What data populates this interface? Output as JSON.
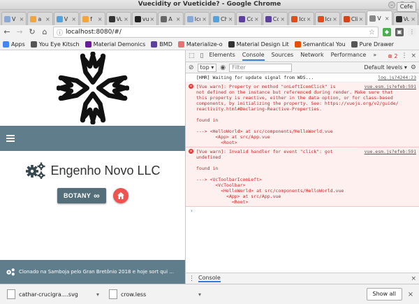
{
  "window": {
    "title": "Vuecidity or Vueticide? - Google Chrome",
    "profile": "Cefe"
  },
  "tabs": [
    {
      "label": "V",
      "color": "#8aa8d6"
    },
    {
      "label": "a",
      "color": "#f3a43a"
    },
    {
      "label": "V",
      "color": "#4fa3e0"
    },
    {
      "label": "f",
      "color": "#f3a43a"
    },
    {
      "label": "Vue",
      "color": "#333333"
    },
    {
      "label": "vue",
      "color": "#222222"
    },
    {
      "label": "A p",
      "color": "#666666"
    },
    {
      "label": "Icon",
      "color": "#8aa8d6"
    },
    {
      "label": "Che",
      "color": "#4fa3e0"
    },
    {
      "label": "Con",
      "color": "#5c3f9e"
    },
    {
      "label": "Con",
      "color": "#5c3f9e"
    },
    {
      "label": "Icon",
      "color": "#e64a19"
    },
    {
      "label": "Icon",
      "color": "#e64a19"
    },
    {
      "label": "Clic",
      "color": "#d84315"
    },
    {
      "label": "V",
      "color": "#888888",
      "active": true
    },
    {
      "label": "Vue",
      "color": "#333333"
    }
  ],
  "address": {
    "url": "localhost:8080/#/"
  },
  "bookmarks": [
    {
      "label": "Apps",
      "color": "#4285f4"
    },
    {
      "label": "You Eye Kitsch",
      "color": "#555555"
    },
    {
      "label": "Material Demonics",
      "color": "#6a1b9a"
    },
    {
      "label": "BMD",
      "color": "#5c3f9e"
    },
    {
      "label": "Materialize-o",
      "color": "#ee6e73"
    },
    {
      "label": "Material Design Lit",
      "color": "#333333"
    },
    {
      "label": "Semantical You",
      "color": "#e65100"
    },
    {
      "label": "Pure Drawer",
      "color": "#555555"
    }
  ],
  "app": {
    "company": "Engenho Novo LLC",
    "botany_label": "BOTANY",
    "footer_text": "Clonado na Samboja pelo Gran Bretônio 2018 e hoje sort qui ...",
    "appbar_color": "#607d8b",
    "accent_color": "#ef5350"
  },
  "devtools": {
    "tabs": [
      "Elements",
      "Console",
      "Sources",
      "Network",
      "Performance"
    ],
    "active_tab": "Console",
    "error_count": "2",
    "context": "top",
    "filter_placeholder": "Filter",
    "levels": "Default levels",
    "messages": [
      {
        "type": "log",
        "lines": [
          "[HMR] Waiting for update signal from WDS..."
        ],
        "source": "log.js?4244:23"
      },
      {
        "type": "error",
        "lines": [
          "[Vue warn]: Property or method \"onLeftIconClick\" is",
          "not defined on the instance but referenced during render. Make sure that",
          "this property is reactive, either in the data option, or for class-based",
          "components, by initializing the property. See: https://vuejs.org/v2/guide/",
          "reactivity.html#Declaring-Reactive-Properties.",
          "",
          "found in",
          "",
          "---> <HelloWorld> at src/components/HelloWorld.vue",
          "       <App> at src/App.vue",
          "         <Root>"
        ],
        "source": "vue.esm.js?efeb:591"
      },
      {
        "type": "error",
        "lines": [
          "[Vue warn]: Invalid handler for event \"click\": got",
          "undefined",
          "",
          "found in",
          "",
          "---> <VcToolbarIconLeft>",
          "       <VcToolbar>",
          "         <HelloWorld> at src/components/HelloWorld.vue",
          "           <App> at src/App.vue",
          "             <Root>"
        ],
        "source": "vue.esm.js?efeb:591"
      }
    ],
    "drawer_label": "Console"
  },
  "downloads": {
    "items": [
      "cathar-crucigra....svg",
      "crow.less"
    ],
    "show_all": "Show all"
  }
}
